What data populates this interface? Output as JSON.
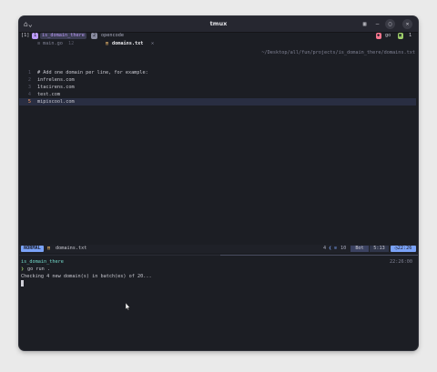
{
  "window": {
    "title": "tmux",
    "buttons": {
      "grid": "▦",
      "minimize": "–",
      "maximize": "▢",
      "close": "✕"
    }
  },
  "tmux_top": {
    "session_index": "[1]",
    "windows": [
      {
        "index": "1",
        "name": "is_domain_there",
        "active": true
      },
      {
        "index": "2",
        "name": "opencode",
        "active": false
      }
    ],
    "right_label": "go",
    "right_count": "1"
  },
  "tabs": [
    {
      "icon": "≡",
      "name": "main.go",
      "extra": "12",
      "active": false
    },
    {
      "icon": "▤",
      "name": "domains.txt",
      "close": "✕",
      "active": true
    }
  ],
  "editor": {
    "path": "~/Desktop/all/fun/projects/is_domain_there/domains.txt",
    "lines": [
      {
        "num": "1",
        "text": "# Add one domain per line, for example:"
      },
      {
        "num": "2",
        "text": "infrelens.com"
      },
      {
        "num": "3",
        "text": "1tacirens.com"
      },
      {
        "num": "4",
        "text": "test.com"
      },
      {
        "num": "5",
        "text": "mipiscool.com",
        "current": true
      }
    ]
  },
  "statusline": {
    "mode": "NORMAL",
    "file_icon": "▤",
    "filename": "domains.txt",
    "col4": "4",
    "lsp": "10",
    "pos_label": "Bot",
    "line_col": "5:13",
    "time": "22:26"
  },
  "terminal": {
    "dir": "is_domain_there",
    "time": "22:26:00",
    "prompt": "❯",
    "command": "go run .",
    "output": "Checking 4 new domain(s) in batch(es) of 20..."
  },
  "colors": {
    "bg": "#1c1e24",
    "accent_blue": "#7aa2f7",
    "cyan": "#73daca",
    "green": "#9ece6a",
    "purple": "#bb9af7",
    "pink": "#f7768e"
  }
}
